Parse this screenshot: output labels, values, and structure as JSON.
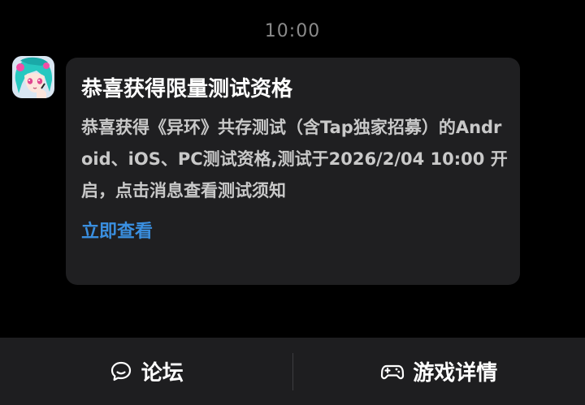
{
  "status": {
    "time": "10:00"
  },
  "app": {
    "avatar_icon": "game-character-avatar-icon"
  },
  "notification": {
    "title": "恭喜获得限量测试资格",
    "body": "恭喜获得《异环》共存测试（含Tap独家招募）的Android、iOS、PC测试资格,测试于2026/2/04 10:00 开启，点击消息查看测试须知",
    "action_label": "立即查看",
    "action_color": "#3a8fe0"
  },
  "bottom_bar": {
    "forum": {
      "label": "论坛",
      "icon": "forum-chat-icon"
    },
    "game_details": {
      "label": "游戏详情",
      "icon": "gamepad-icon"
    }
  },
  "colors": {
    "background": "#000000",
    "bubble": "#1f1f21",
    "bar": "#1e1e20"
  }
}
